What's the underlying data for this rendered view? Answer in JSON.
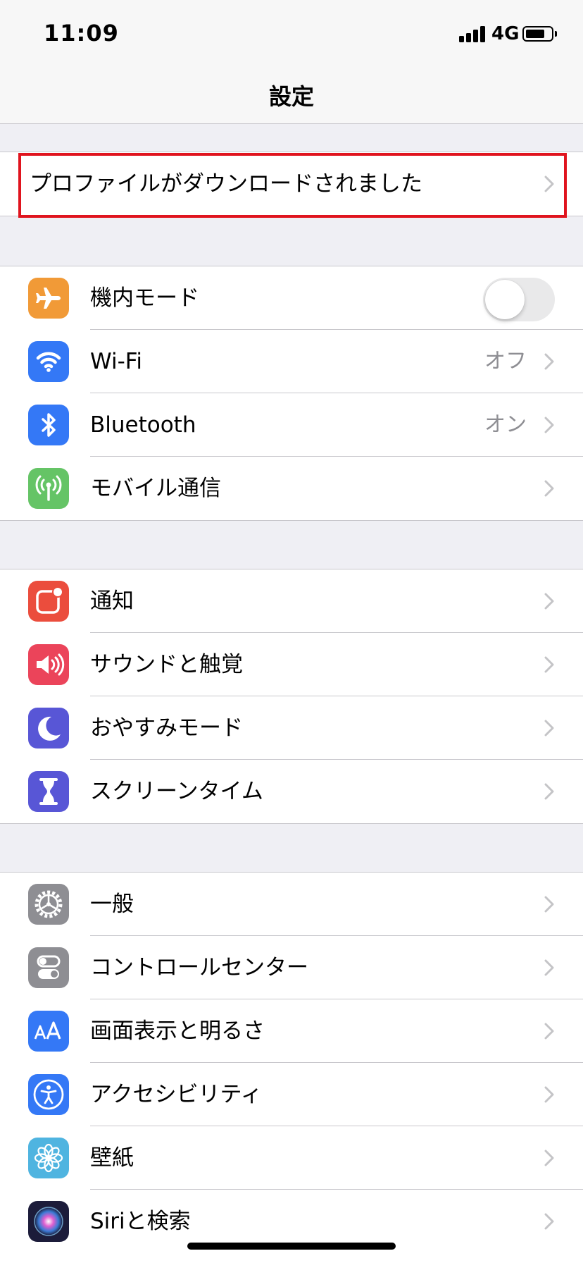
{
  "status_bar": {
    "time": "11:09",
    "network": "4G"
  },
  "nav": {
    "title": "設定"
  },
  "profile": {
    "label": "プロファイルがダウンロードされました"
  },
  "connectivity": [
    {
      "label": "機内モード",
      "icon": "airplane-icon",
      "color": "#f19a37",
      "toggle": false
    },
    {
      "label": "Wi-Fi",
      "icon": "wifi-icon",
      "color": "#3478f6",
      "value": "オフ"
    },
    {
      "label": "Bluetooth",
      "icon": "bluetooth-icon",
      "color": "#3478f6",
      "value": "オン"
    },
    {
      "label": "モバイル通信",
      "icon": "antenna-icon",
      "color": "#65c466"
    }
  ],
  "notifications": [
    {
      "label": "通知",
      "icon": "notifications-icon",
      "color": "#eb4d3d"
    },
    {
      "label": "サウンドと触覚",
      "icon": "speaker-icon",
      "color": "#eb445a"
    },
    {
      "label": "おやすみモード",
      "icon": "moon-icon",
      "color": "#5856d6"
    },
    {
      "label": "スクリーンタイム",
      "icon": "hourglass-icon",
      "color": "#5856d6"
    }
  ],
  "general": [
    {
      "label": "一般",
      "icon": "gear-icon",
      "color": "#8e8e93"
    },
    {
      "label": "コントロールセンター",
      "icon": "switches-icon",
      "color": "#8e8e93"
    },
    {
      "label": "画面表示と明るさ",
      "icon": "text-size-icon",
      "color": "#3478f6"
    },
    {
      "label": "アクセシビリティ",
      "icon": "accessibility-icon",
      "color": "#3478f6"
    },
    {
      "label": "壁紙",
      "icon": "flower-icon",
      "color": "#4fb4e0"
    },
    {
      "label": "Siriと検索",
      "icon": "siri-icon",
      "color": "#1c1c3a"
    }
  ]
}
